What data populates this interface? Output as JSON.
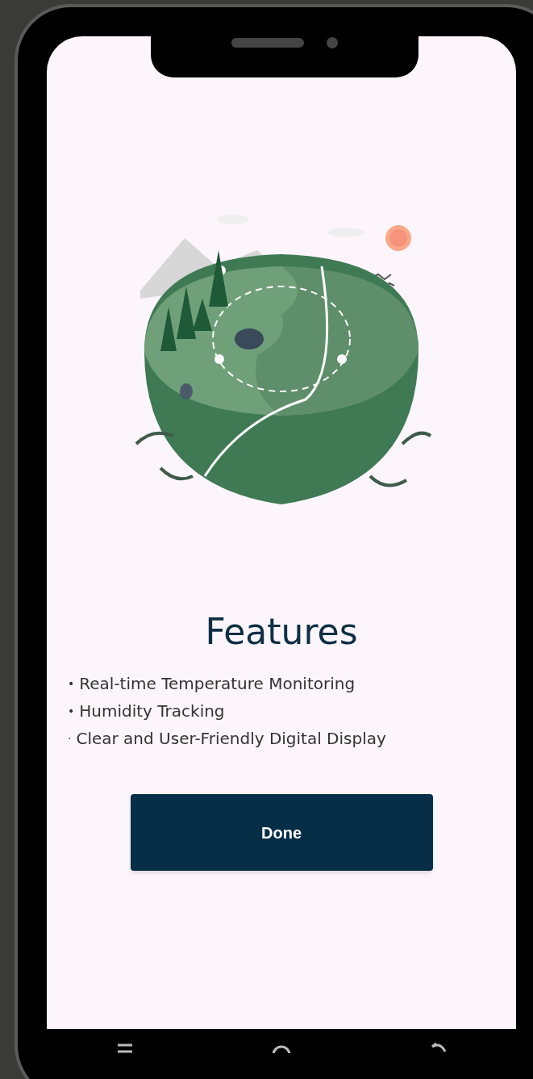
{
  "screen": {
    "title": "Features",
    "features": [
      {
        "bullet": "•",
        "text": "Real-time Temperature Monitoring"
      },
      {
        "bullet": "•",
        "text": "Humidity Tracking"
      },
      {
        "bullet": "·",
        "text": "Clear and User-Friendly Digital Display"
      }
    ],
    "button": "Done"
  }
}
